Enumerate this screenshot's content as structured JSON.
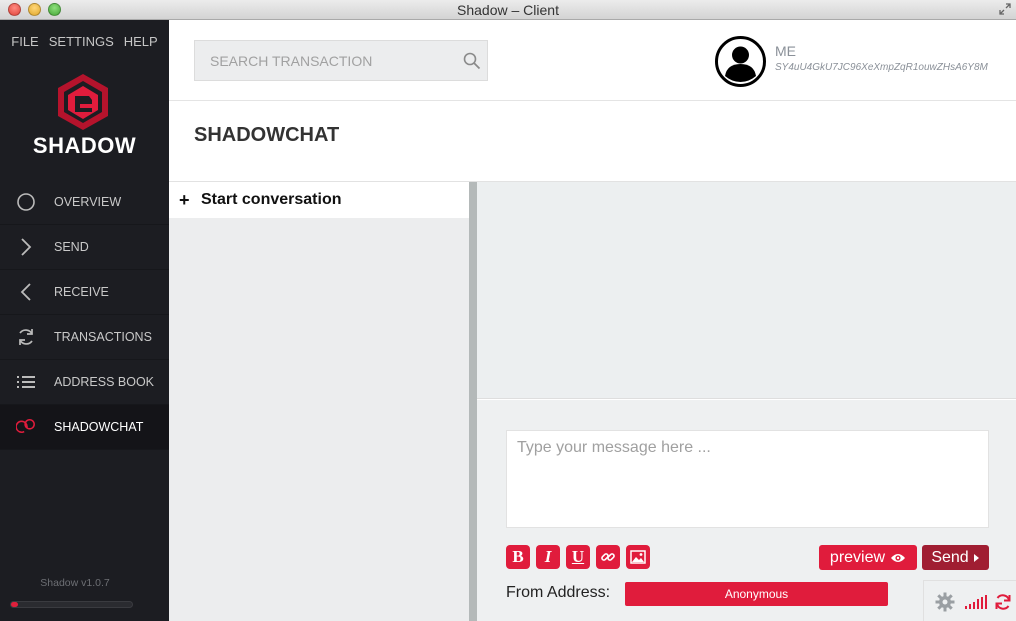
{
  "window": {
    "title": "Shadow – Client"
  },
  "menu": {
    "items": [
      "FILE",
      "SETTINGS",
      "HELP"
    ]
  },
  "brand": {
    "name": "SHADOW",
    "accent": "#e01c3c"
  },
  "nav": {
    "items": [
      {
        "label": "OVERVIEW",
        "icon": "circle-icon"
      },
      {
        "label": "SEND",
        "icon": "chevron-right-icon"
      },
      {
        "label": "RECEIVE",
        "icon": "chevron-left-icon"
      },
      {
        "label": "TRANSACTIONS",
        "icon": "refresh-icon"
      },
      {
        "label": "ADDRESS BOOK",
        "icon": "list-icon"
      },
      {
        "label": "SHADOWCHAT",
        "icon": "chat-icon",
        "active": true
      }
    ]
  },
  "version": "Shadow v1.0.7",
  "sync_progress": 0.06,
  "search": {
    "placeholder": "SEARCH TRANSACTION"
  },
  "user": {
    "name": "ME",
    "address": "SY4uU4GkU7JC96XeXmpZqR1ouwZHsA6Y8M"
  },
  "page": {
    "title": "SHADOWCHAT"
  },
  "conversations": {
    "start_label": "Start conversation"
  },
  "compose": {
    "placeholder": "Type your message here ...",
    "format_buttons": [
      "B",
      "I",
      "U"
    ],
    "preview_label": "preview",
    "send_label": "Send",
    "from_label": "From Address:",
    "from_value": "Anonymous"
  }
}
